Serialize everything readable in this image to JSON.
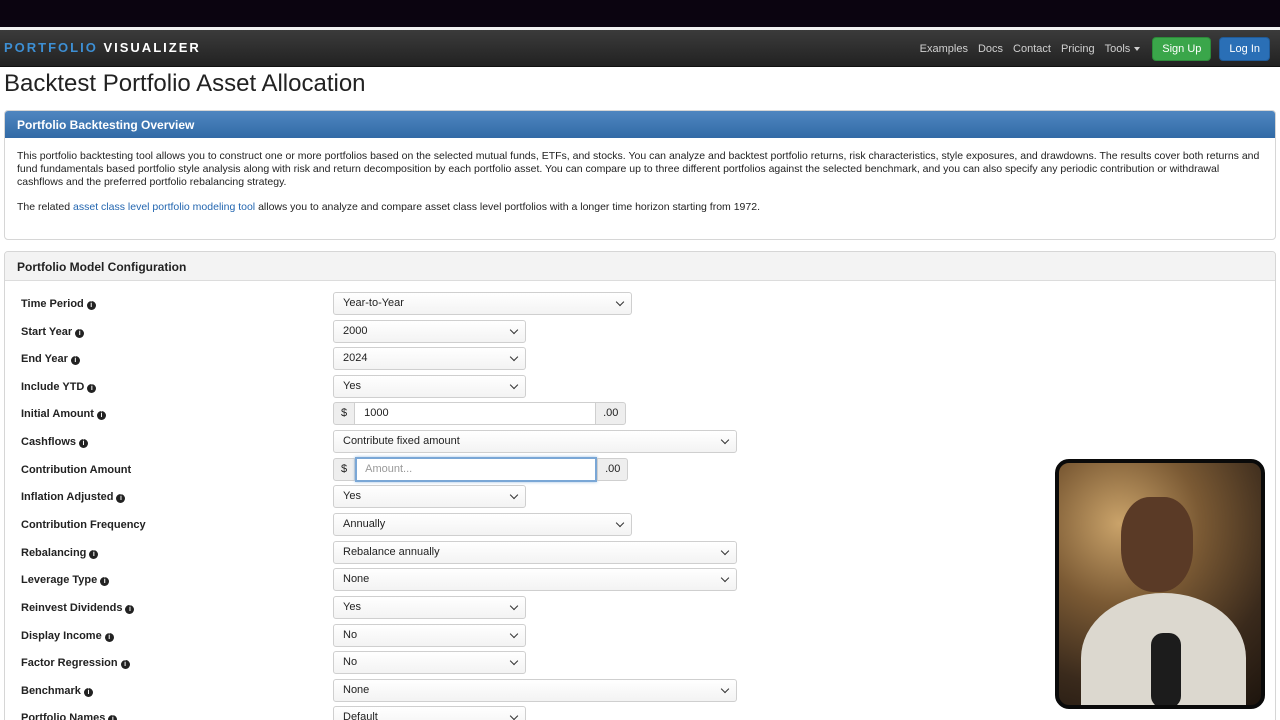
{
  "navbar": {
    "brand_part1": "PORTFOLIO",
    "brand_part2": "VISUALIZER",
    "links": [
      "Examples",
      "Docs",
      "Contact",
      "Pricing",
      "Tools"
    ],
    "signup": "Sign Up",
    "login": "Log In",
    "signup_color": "#3aa64a",
    "login_color": "#2a6fb6"
  },
  "page_title": "Backtest Portfolio Asset Allocation",
  "overview": {
    "heading": "Portfolio Backtesting Overview",
    "para1": "This portfolio backtesting tool allows you to construct one or more portfolios based on the selected mutual funds, ETFs, and stocks. You can analyze and backtest portfolio returns, risk characteristics, style exposures, and drawdowns. The results cover both returns and fund fundamentals based portfolio style analysis along with risk and return decomposition by each portfolio asset. You can compare up to three different portfolios against the selected benchmark, and you can also specify any periodic contribution or withdrawal cashflows and the preferred portfolio rebalancing strategy.",
    "para2_before": "The related ",
    "para2_link": "asset class level portfolio modeling tool",
    "para2_after": " allows you to analyze and compare asset class level portfolios with a longer time horizon starting from 1972."
  },
  "config": {
    "heading": "Portfolio Model Configuration",
    "rows": {
      "time_period": {
        "label": "Time Period",
        "value": "Year-to-Year"
      },
      "start_year": {
        "label": "Start Year",
        "value": "2000"
      },
      "end_year": {
        "label": "End Year",
        "value": "2024"
      },
      "include_ytd": {
        "label": "Include YTD",
        "value": "Yes"
      },
      "initial_amount": {
        "label": "Initial Amount",
        "prefix": "$",
        "value": "1000",
        "suffix": ".00"
      },
      "cashflows": {
        "label": "Cashflows",
        "value": "Contribute fixed amount"
      },
      "contribution_amount": {
        "label": "Contribution Amount",
        "prefix": "$",
        "placeholder": "Amount...",
        "suffix": ".00"
      },
      "inflation_adjusted": {
        "label": "Inflation Adjusted",
        "value": "Yes"
      },
      "contribution_frequency": {
        "label": "Contribution Frequency",
        "value": "Annually"
      },
      "rebalancing": {
        "label": "Rebalancing",
        "value": "Rebalance annually"
      },
      "leverage_type": {
        "label": "Leverage Type",
        "value": "None"
      },
      "reinvest_dividends": {
        "label": "Reinvest Dividends",
        "value": "Yes"
      },
      "display_income": {
        "label": "Display Income",
        "value": "No"
      },
      "factor_regression": {
        "label": "Factor Regression",
        "value": "No"
      },
      "benchmark": {
        "label": "Benchmark",
        "value": "None"
      },
      "portfolio_names": {
        "label": "Portfolio Names",
        "value": "Default"
      }
    }
  }
}
